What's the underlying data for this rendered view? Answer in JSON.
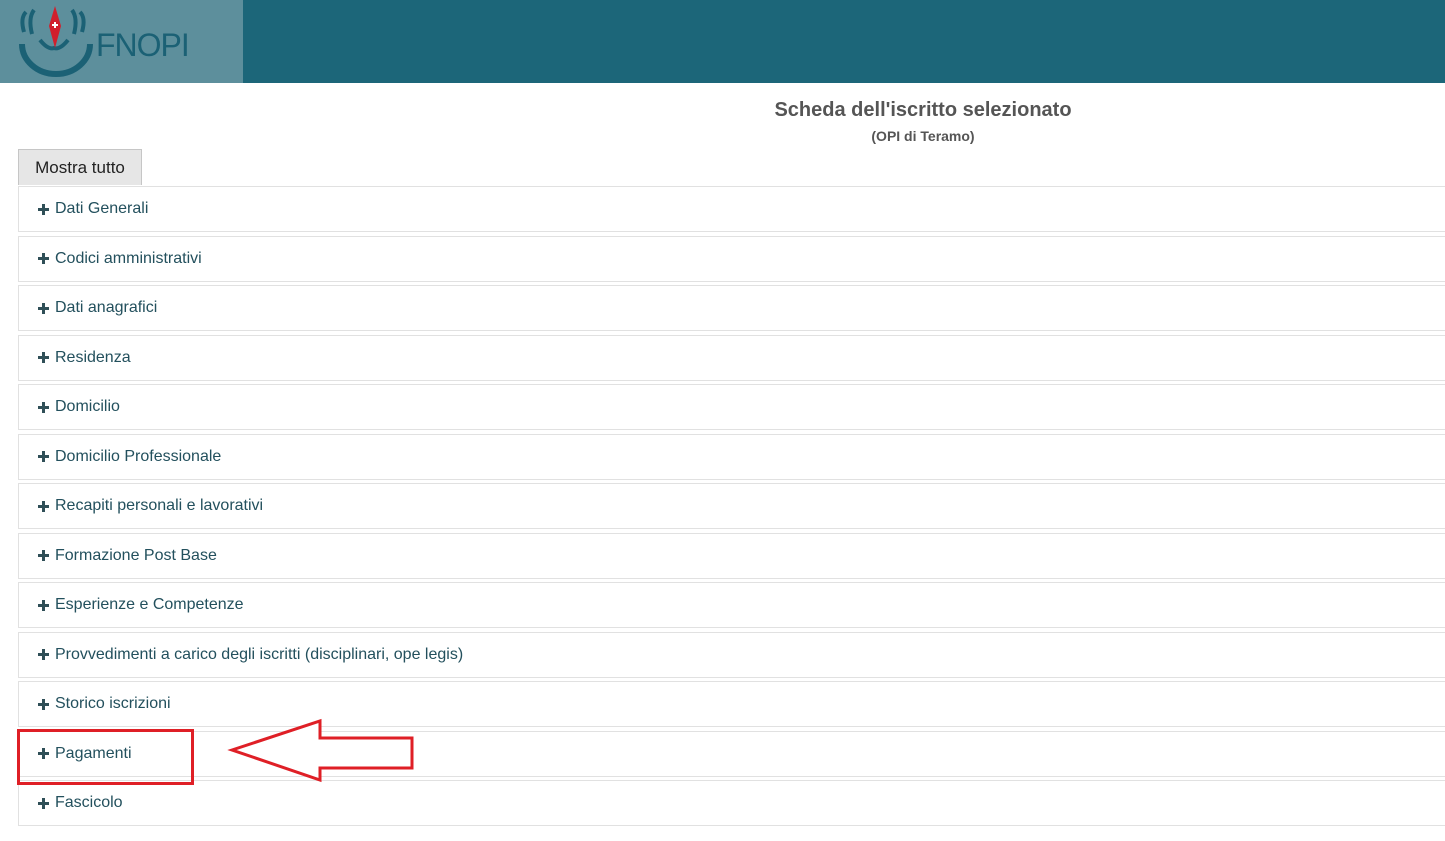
{
  "header": {
    "logo_text": "FNOPI",
    "colors": {
      "bar": "#1c6679",
      "logo_box": "#5d8f9c",
      "logo_green": "#1b6175",
      "logo_red": "#d11f2c"
    }
  },
  "page": {
    "title": "Scheda dell'iscritto selezionato",
    "subtitle": "(OPI di Teramo)"
  },
  "toolbar": {
    "show_all_label": "Mostra tutto"
  },
  "sections": [
    {
      "label": "Dati Generali"
    },
    {
      "label": "Codici amministrativi"
    },
    {
      "label": "Dati anagrafici"
    },
    {
      "label": "Residenza"
    },
    {
      "label": "Domicilio"
    },
    {
      "label": "Domicilio Professionale"
    },
    {
      "label": "Recapiti personali e lavorativi"
    },
    {
      "label": "Formazione Post Base"
    },
    {
      "label": "Esperienze e Competenze"
    },
    {
      "label": "Provvedimenti a carico degli iscritti (disciplinari, ope legis)"
    },
    {
      "label": "Storico iscrizioni"
    },
    {
      "label": "Pagamenti"
    },
    {
      "label": "Fascicolo"
    }
  ],
  "annotation": {
    "highlighted_section": "Pagamenti",
    "color": "#df1f26"
  }
}
